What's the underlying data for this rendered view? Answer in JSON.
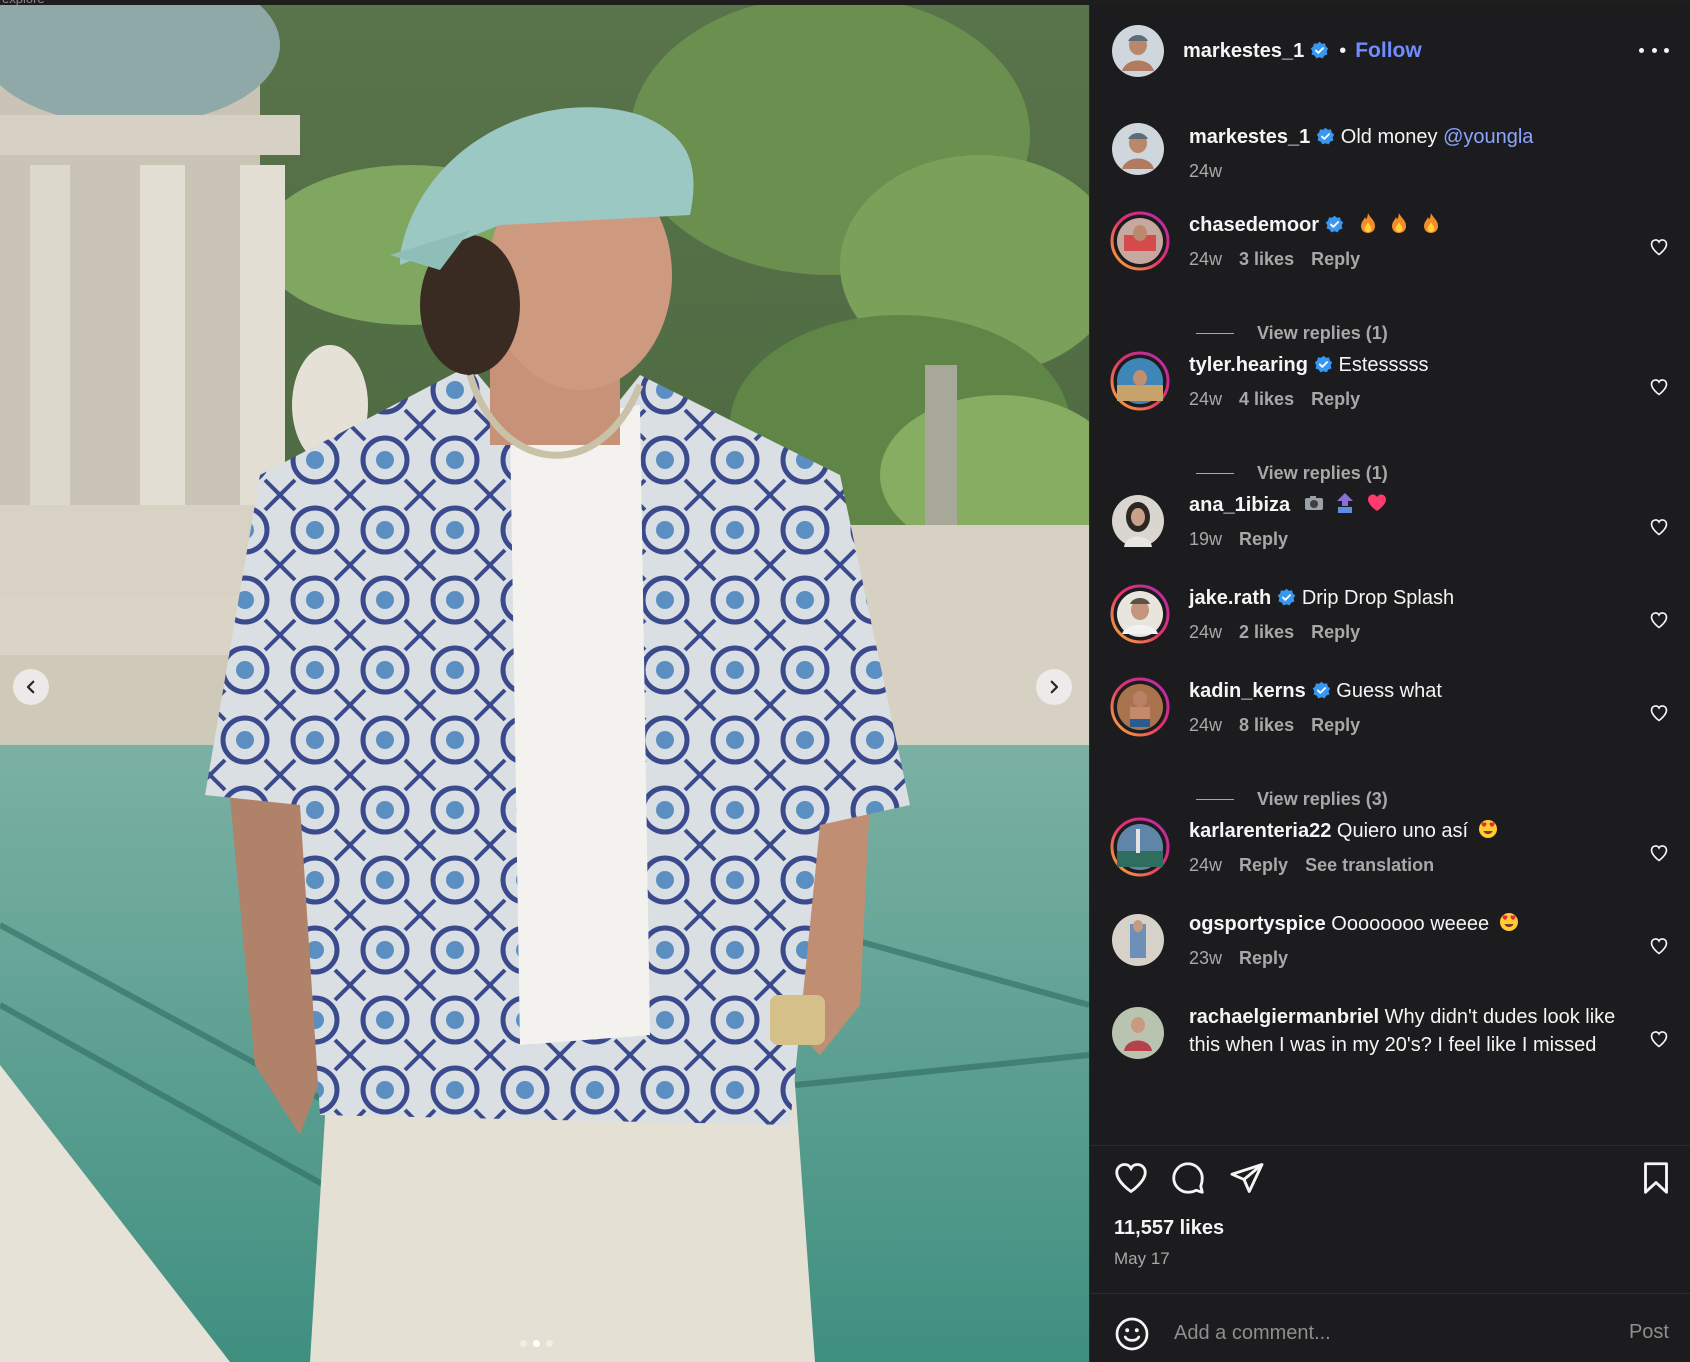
{
  "top_strip": {
    "text": "explore"
  },
  "post": {
    "author": "markestes_1",
    "follow_label": "Follow",
    "caption_text": "Old money",
    "caption_mention": "@youngla",
    "caption_time": "24w",
    "likes": "11,557 likes",
    "date": "May 17",
    "carousel": {
      "total": 3,
      "active_index": 1
    }
  },
  "comments": [
    {
      "user": "chasedemoor",
      "verified": true,
      "text": "",
      "emojis": [
        "fire-emoji",
        "fire-emoji",
        "fire-emoji"
      ],
      "time": "24w",
      "likes": "3 likes",
      "reply": "Reply",
      "view_replies": "View replies (1)"
    },
    {
      "user": "tyler.hearing",
      "verified": true,
      "text": "Estesssss",
      "time": "24w",
      "likes": "4 likes",
      "reply": "Reply",
      "view_replies": "View replies (1)"
    },
    {
      "user": "ana_1ibiza",
      "verified": false,
      "text": "",
      "emojis": [
        "camera-emoji",
        "top-arrow-emoji",
        "heart-emoji"
      ],
      "time": "19w",
      "reply": "Reply"
    },
    {
      "user": "jake.rath",
      "verified": true,
      "text": "Drip Drop Splash",
      "time": "24w",
      "likes": "2 likes",
      "reply": "Reply"
    },
    {
      "user": "kadin_kerns",
      "verified": true,
      "text": "Guess what",
      "time": "24w",
      "likes": "8 likes",
      "reply": "Reply",
      "view_replies": "View replies (3)"
    },
    {
      "user": "karlarenteria22",
      "verified": false,
      "text": "Quiero uno así",
      "emojis": [
        "heart-eyes-emoji"
      ],
      "time": "24w",
      "reply": "Reply",
      "translation": "See translation"
    },
    {
      "user": "ogsportyspice",
      "verified": false,
      "text": "Oooooooo weeee",
      "emojis": [
        "heart-eyes-emoji"
      ],
      "time": "23w",
      "reply": "Reply"
    },
    {
      "user": "rachaelgiermanbriel",
      "verified": false,
      "text": "Why didn't dudes look like this when I was in my 20's? I feel like I missed"
    }
  ],
  "comment_box": {
    "placeholder": "Add a comment...",
    "post_label": "Post"
  },
  "colors": {
    "panel_bg": "#1c1c1e",
    "link_blue": "#6f8dff",
    "mention_blue": "#8ea4ff",
    "verified_blue": "#3897f0",
    "muted": "#a8a8a8"
  },
  "icons": [
    "chevron-left-icon",
    "chevron-right-icon",
    "more-icon",
    "heart-icon",
    "comment-icon",
    "share-icon",
    "bookmark-icon",
    "emoji-icon",
    "verified-icon"
  ]
}
